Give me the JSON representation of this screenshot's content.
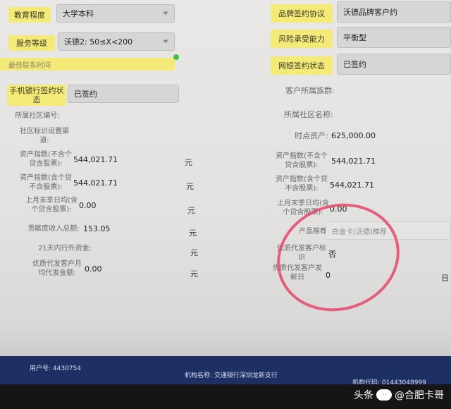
{
  "left": {
    "education": {
      "label": "教育程度",
      "value": "大学本科"
    },
    "service_level": {
      "label": "服务等级",
      "value": "沃德2: 50≤X<200"
    },
    "best_contact_time": {
      "label": "最佳联系时间"
    },
    "mobile_bank_status": {
      "label": "手机银行签约状态",
      "value": "已签约"
    },
    "community_no": {
      "label": "所属社区编号:"
    },
    "community_channel": {
      "label": "社区标识设置渠道:"
    },
    "asset_index_excl": {
      "label": "资产指数(不含个贷含股票):",
      "value": "544,021.71",
      "unit": "元"
    },
    "asset_index_incl": {
      "label": "资产指数(含个贷不含股票):",
      "value": "544,021.71",
      "unit": "元"
    },
    "last_month_avg": {
      "label": "上月末季日均(含个贷含股票):",
      "value": "0.00",
      "unit": "元"
    },
    "contribution_income": {
      "label": "贡献度收入总额:",
      "value": "153.05",
      "unit": "元"
    },
    "d21_funds": {
      "label": "21天内行外资金:",
      "unit": "元"
    },
    "agent_amount": {
      "label": "优质代发客户月均代发金额:",
      "value": "0.00",
      "unit": "元"
    }
  },
  "right": {
    "brand_agreement": {
      "label": "品牌签约协议",
      "value": "沃德品牌客户约"
    },
    "risk_capacity": {
      "label": "风险承受能力",
      "value": "平衡型"
    },
    "netbank_status": {
      "label": "网银签约状态",
      "value": "已签约"
    },
    "community_group": {
      "label": "客户所属族群:"
    },
    "community_name": {
      "label": "所属社区名称:"
    },
    "point_assets": {
      "label": "时点资产:",
      "value": "625,000.00"
    },
    "asset_index_excl": {
      "label": "资产指数(不含个贷含股票):",
      "value": "544,021.71"
    },
    "asset_index_incl": {
      "label": "资产指数(含个贷不含股票):",
      "value": "544,021.71"
    },
    "last_month_avg": {
      "label": "上月末季日均(含个贷含股票):",
      "value": "0.00"
    },
    "product_recommend": {
      "label": "产品推荐",
      "value": "白金卡(沃德)推荐"
    },
    "agent_flag": {
      "label": "优质代发客户标识",
      "value": "否"
    },
    "agent_day": {
      "label": "优质代发客户发薪日",
      "value": "0",
      "unit": "日"
    }
  },
  "statusbar": {
    "user": "用户号: 4430754",
    "org": "机构名称: 交通银行深圳龙新支行",
    "org_code": "机构代码: 01443048999"
  },
  "watermark": {
    "brand": "头条",
    "handle": "@合肥卡哥",
    "badge": "ᐧᐧ"
  },
  "colors": {
    "label_yellow": "#f4ea78",
    "field_gray": "#d6d6d6",
    "status_navy": "#1d2f63",
    "red_circle": "#e5476a",
    "green_dot": "#46c046"
  }
}
